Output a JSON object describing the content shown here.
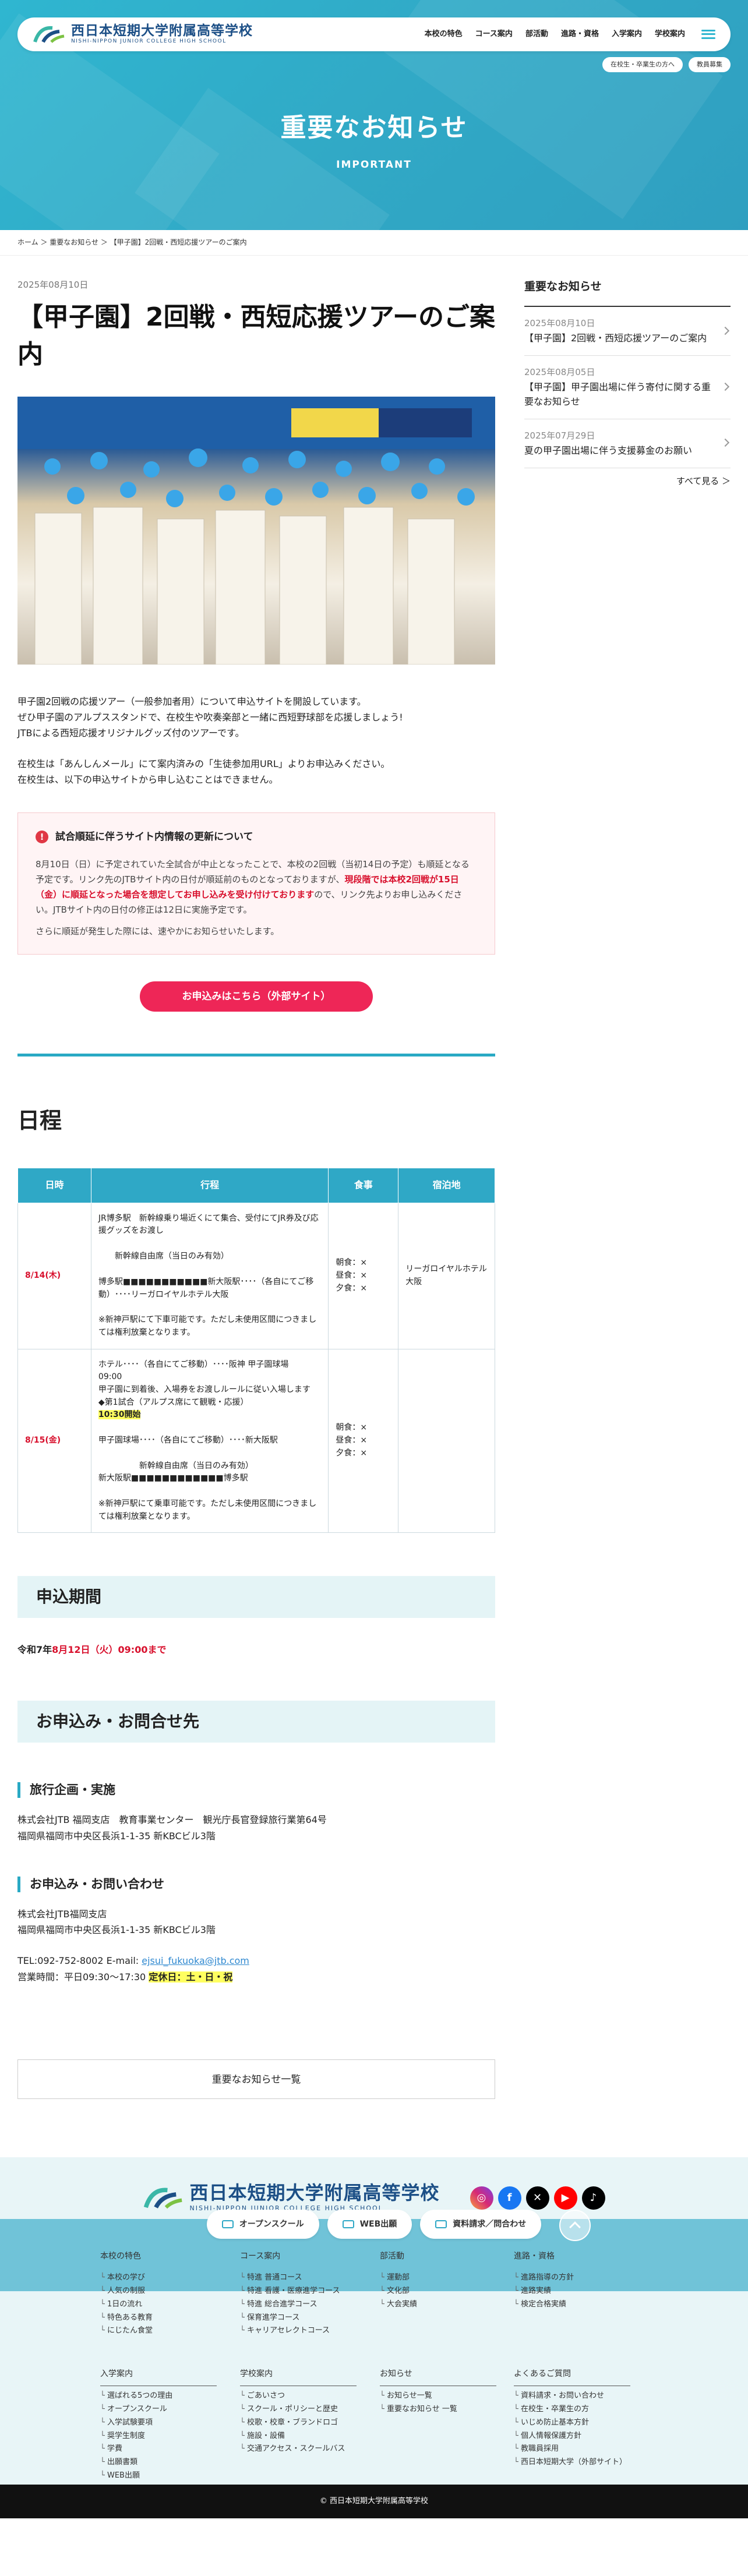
{
  "header": {
    "logo_jp": "西日本短期大学附属高等学校",
    "logo_en": "NISHI-NIPPON JUNIOR COLLEGE HIGH SCHOOL",
    "nav": [
      "本校の特色",
      "コース案内",
      "部活動",
      "進路・資格",
      "入学案内",
      "学校案内"
    ],
    "subnav": [
      "在校生・卒業生の方へ",
      "教員募集"
    ]
  },
  "hero": {
    "title": "重要なお知らせ",
    "subtitle": "IMPORTANT"
  },
  "breadcrumb": "ホーム ＞ 重要なお知らせ ＞ 【甲子園】2回戦・西短応援ツアーのご案内",
  "article": {
    "date": "2025年08月10日",
    "title": "【甲子園】2回戦・西短応援ツアーのご案内",
    "intro": [
      "甲子園2回戦の応援ツアー（一般参加者用）について申込サイトを開設しています。",
      "ぜひ甲子園のアルプススタンドで、在校生や吹奏楽部と一緒に西短野球部を応援しましょう!",
      "JTBによる西短応援オリジナルグッズ付のツアーです。",
      "",
      "在校生は「あんしんメール」にて案内済みの「生徒参加用URL」よりお申込みください。",
      "在校生は、以下の申込サイトから申し込むことはできません。"
    ],
    "notice": {
      "icon": "!",
      "heading": "試合順延に伴うサイト内情報の更新について",
      "body_1": "8月10日（日）に予定されていた全試合が中止となったことで、本校の2回戦（当初14日の予定）も順延となる予定です。リンク先のJTBサイト内の日付が順延前のものとなっておりますが、",
      "body_red": "現段階では本校2回戦が15日（金）に順延となった場合を想定してお申し込みを受け付けております",
      "body_2": "ので、リンク先よりお申し込みください。JTBサイト内の日付の修正は12日に実施予定です。",
      "body_3": "さらに順延が発生した際には、速やかにお知らせいたします。"
    },
    "apply_button": "お申込みはこちら（外部サイト）",
    "schedule_title": "日程",
    "schedule_headers": [
      "日時",
      "行程",
      "食事",
      "宿泊地"
    ],
    "schedule": [
      {
        "day": "8/14(木)",
        "lines": [
          "JR博多駅　新幹線乗り場近くにて集合、受付にてJR券及び応援グッズをお渡し",
          "",
          "　　新幹線自由席（当日のみ有効）",
          "",
          "博多駅■■■■■■■■■■■新大阪駅････（各自にてご移動）････リーガロイヤルホテル大阪",
          "",
          "※新神戸駅にて下車可能です。ただし未使用区間につきましては権利放棄となります。"
        ],
        "meal": [
          "朝食：×",
          "昼食：×",
          "夕食：×"
        ],
        "hotel": "リーガロイヤルホテル大阪"
      },
      {
        "day": "8/15(金)",
        "lines": [
          "ホテル････（各自にてご移動）････阪神 甲子園球場",
          "09:00",
          "甲子園に到着後、入場券をお渡しルールに従い入場します",
          "◆第1試合（アルプス席にて観戦・応援）",
          "__10:30開始",
          "",
          "甲子園球場････（各自にてご移動）････新大阪駅",
          "",
          "　　　　　新幹線自由席（当日のみ有効）",
          "新大阪駅■■■■■■■■■■■■博多駅",
          "",
          "※新神戸駅にて乗車可能です。ただし未使用区間につきましては権利放棄となります。"
        ],
        "meal": [
          "朝食：×",
          "昼食：×",
          "夕食：×"
        ],
        "hotel": ""
      }
    ],
    "period_title": "申込期間",
    "period_prefix": "令和7年",
    "period_red": "8月12日（火）09:00まで",
    "contact_band": "お申込み・お問合せ先",
    "org_title": "旅行企画・実施",
    "org_lines": [
      "株式会社JTB 福岡支店　教育事業センター　観光庁長官登録旅行業第64号",
      "福岡県福岡市中央区長浜1-1-35 新KBCビル3階"
    ],
    "inq_title": "お申込み・お問い合わせ",
    "inq_lines": [
      "株式会社JTB福岡支店",
      "福岡県福岡市中央区長浜1-1-35 新KBCビル3階"
    ],
    "tel_line": "TEL:092-752-8002 E-mail: ",
    "email": "ejsui_fukuoka@jtb.com",
    "hours_prefix": "営業時間：平日09:30〜17:30 ",
    "hours_hl": "定休日：土・日・祝",
    "list_button": "重要なお知らせ一覧"
  },
  "sidebar": {
    "title": "重要なお知らせ",
    "items": [
      {
        "date": "2025年08月10日",
        "text": "【甲子園】2回戦・西短応援ツアーのご案内"
      },
      {
        "date": "2025年08月05日",
        "text": "【甲子園】甲子園出場に伴う寄付に関する重要なお知らせ"
      },
      {
        "date": "2025年07月29日",
        "text": "夏の甲子園出場に伴う支援募金のお願い"
      }
    ],
    "more": "すべて見る ＞"
  },
  "footer": {
    "logo_jp": "西日本短期大学附属高等学校",
    "logo_en": "NISHI-NIPPON JUNIOR COLLEGE HIGH SCHOOL",
    "buttons": [
      "オープンスクール",
      "WEB出願",
      "資料請求／問合わせ"
    ],
    "social_icons": [
      "instagram-icon",
      "facebook-icon",
      "x-icon",
      "youtube-icon",
      "tiktok-icon"
    ],
    "cols_top": [
      {
        "h": "本校の特色",
        "items": [
          "本校の学び",
          "人気の制服",
          "1日の流れ",
          "特色ある教育",
          "にじたん食堂"
        ]
      },
      {
        "h": "コース案内",
        "items": [
          "特進 普通コース",
          "特進 看護・医療進学コース",
          "特進 総合進学コース",
          "保育進学コース",
          "キャリアセレクトコース"
        ]
      },
      {
        "h": "部活動",
        "items": [
          "運動部",
          "文化部",
          "大会実績"
        ]
      },
      {
        "h": "進路・資格",
        "items": [
          "進路指導の方針",
          "進路実績",
          "検定合格実績"
        ]
      }
    ],
    "cols_bottom": [
      {
        "h": "入学案内",
        "items": [
          "選ばれる5つの理由",
          "オープンスクール",
          "入学試験要項",
          "奨学生制度",
          "学費",
          "出願書類",
          "WEB出願"
        ]
      },
      {
        "h": "学校案内",
        "items": [
          "ごあいさつ",
          "スクール・ポリシーと歴史",
          "校歌・校章・ブランドロゴ",
          "施設・設備",
          "交通アクセス・スクールバス"
        ]
      },
      {
        "h": "お知らせ",
        "items": [
          "お知らせ一覧",
          "重要なお知らせ 一覧"
        ]
      },
      {
        "h": "よくあるご質問",
        "items": [
          "資料請求・お問い合わせ",
          "在校生・卒業生の方",
          "いじめ防止基本方針",
          "個人情報保護方針",
          "教職員採用",
          "西日本短期大学（外部サイト）"
        ]
      }
    ],
    "copyright": "© 西日本短期大学附属高等学校"
  }
}
